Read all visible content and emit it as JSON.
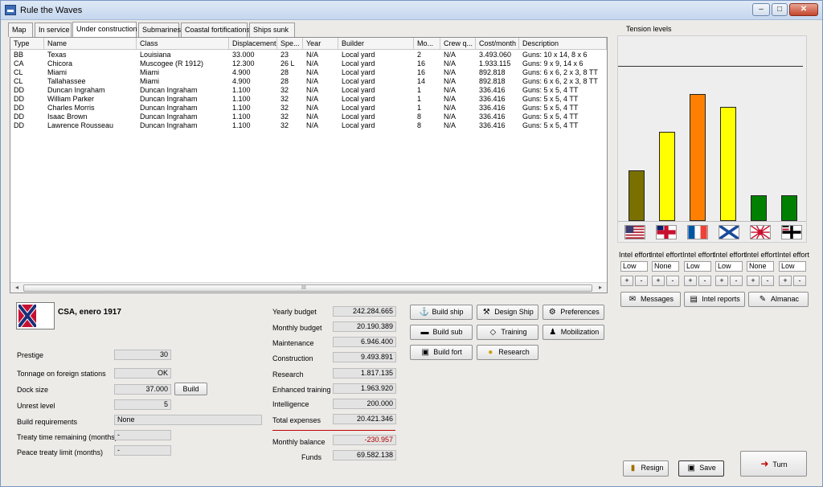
{
  "window": {
    "title": "Rule the Waves",
    "min": "‒",
    "max": "□",
    "close": "✕"
  },
  "tabs": [
    {
      "label": "Map",
      "active": false
    },
    {
      "label": "In service",
      "active": false
    },
    {
      "label": "Under construction",
      "active": true
    },
    {
      "label": "Submarines",
      "active": false
    },
    {
      "label": "Coastal fortifications",
      "active": false
    },
    {
      "label": "Ships sunk",
      "active": false
    }
  ],
  "table": {
    "columns": [
      "Type",
      "Name",
      "Class",
      "Displacement",
      "Spe...",
      "Year",
      "Builder",
      "Mo...",
      "Crew q...",
      "Cost/month",
      "Description"
    ],
    "rows": [
      [
        "BB",
        "Texas",
        "Louisiana",
        "33.000",
        "23",
        "N/A",
        "Local yard",
        "2",
        "N/A",
        "3.493.060",
        "Guns: 10 x 14, 8 x 6"
      ],
      [
        "CA",
        "Chicora",
        "Muscogee (R 1912)",
        "12.300",
        "26 L",
        "N/A",
        "Local yard",
        "16",
        "N/A",
        "1.933.115",
        "Guns: 9 x 9, 14 x 6"
      ],
      [
        "CL",
        "Miami",
        "Miami",
        "4.900",
        "28",
        "N/A",
        "Local yard",
        "16",
        "N/A",
        "892.818",
        "Guns: 6 x 6, 2 x 3, 8 TT"
      ],
      [
        "CL",
        "Tallahassee",
        "Miami",
        "4.900",
        "28",
        "N/A",
        "Local yard",
        "14",
        "N/A",
        "892.818",
        "Guns: 6 x 6, 2 x 3, 8 TT"
      ],
      [
        "DD",
        "Duncan Ingraham",
        "Duncan Ingraham",
        "1.100",
        "32",
        "N/A",
        "Local yard",
        "1",
        "N/A",
        "336.416",
        "Guns: 5 x 5, 4 TT"
      ],
      [
        "DD",
        "William Parker",
        "Duncan Ingraham",
        "1.100",
        "32",
        "N/A",
        "Local yard",
        "1",
        "N/A",
        "336.416",
        "Guns: 5 x 5, 4 TT"
      ],
      [
        "DD",
        "Charles Morris",
        "Duncan Ingraham",
        "1.100",
        "32",
        "N/A",
        "Local yard",
        "1",
        "N/A",
        "336.416",
        "Guns: 5 x 5, 4 TT"
      ],
      [
        "DD",
        "Isaac Brown",
        "Duncan Ingraham",
        "1.100",
        "32",
        "N/A",
        "Local yard",
        "8",
        "N/A",
        "336.416",
        "Guns: 5 x 5, 4 TT"
      ],
      [
        "DD",
        "Lawrence Rousseau",
        "Duncan Ingraham",
        "1.100",
        "32",
        "N/A",
        "Local yard",
        "8",
        "N/A",
        "336.416",
        "Guns: 5 x 5, 4 TT"
      ]
    ],
    "scroll_left": "◂",
    "scroll_right": "▸",
    "scroll_grip": "III"
  },
  "nation": {
    "title": "CSA, enero 1917"
  },
  "status": {
    "prestige_label": "Prestige",
    "prestige": "30",
    "tonnage_label": "Tonnage on foreign stations",
    "tonnage": "OK",
    "dock_label": "Dock size",
    "dock": "37.000",
    "build_label": "Build",
    "unrest_label": "Unrest level",
    "unrest": "5",
    "buildreq_label": "Build requirements",
    "buildreq": "None",
    "treaty_label": "Treaty time remaining (months)",
    "treaty": "-",
    "peace_label": "Peace treaty limit (months)",
    "peace": "-"
  },
  "budget": {
    "yearly_label": "Yearly budget",
    "yearly": "242.284.665",
    "monthly_label": "Monthly budget",
    "monthly": "20.190.389",
    "maintenance_label": "Maintenance",
    "maintenance": "6.946.400",
    "construction_label": "Construction",
    "construction": "9.493.891",
    "research_label": "Research",
    "research": "1.817.135",
    "training_label": "Enhanced training",
    "training": "1.963.920",
    "intelligence_label": "Intelligence",
    "intelligence": "200.000",
    "total_label": "Total expenses",
    "total": "20.421.346",
    "balance_label": "Monthly balance",
    "balance": "-230.957",
    "funds_label": "Funds",
    "funds": "69.582.138",
    "balance_color": "#b00000"
  },
  "actions": {
    "build_ship": "Build ship",
    "design_ship": "Design Ship",
    "preferences": "Preferences",
    "build_sub": "Build sub",
    "training": "Training",
    "mobilization": "Mobilization",
    "build_fort": "Build fort",
    "research": "Research",
    "messages": "Messages",
    "intel_reports": "Intel reports",
    "almanac": "Almanac",
    "resign": "Resign",
    "save": "Save",
    "turn": "Turn"
  },
  "tension": {
    "title": "Tension levels",
    "intel_label": "Intel effort",
    "plus": "+",
    "minus": "-",
    "levels": [
      {
        "nation": "usa-flag",
        "value": 0.4,
        "color": "#7a7000",
        "intel": "Low"
      },
      {
        "nation": "uk-flag",
        "value": 0.7,
        "color": "#ffff00",
        "intel": "None"
      },
      {
        "nation": "france-flag",
        "value": 1.0,
        "color": "#ff7f00",
        "intel": "Low"
      },
      {
        "nation": "russia-flag",
        "value": 0.9,
        "color": "#ffff00",
        "intel": "Low"
      },
      {
        "nation": "japan-flag",
        "value": 0.2,
        "color": "#008000",
        "intel": "None"
      },
      {
        "nation": "germany-flag",
        "value": 0.2,
        "color": "#008000",
        "intel": "Low"
      }
    ]
  }
}
